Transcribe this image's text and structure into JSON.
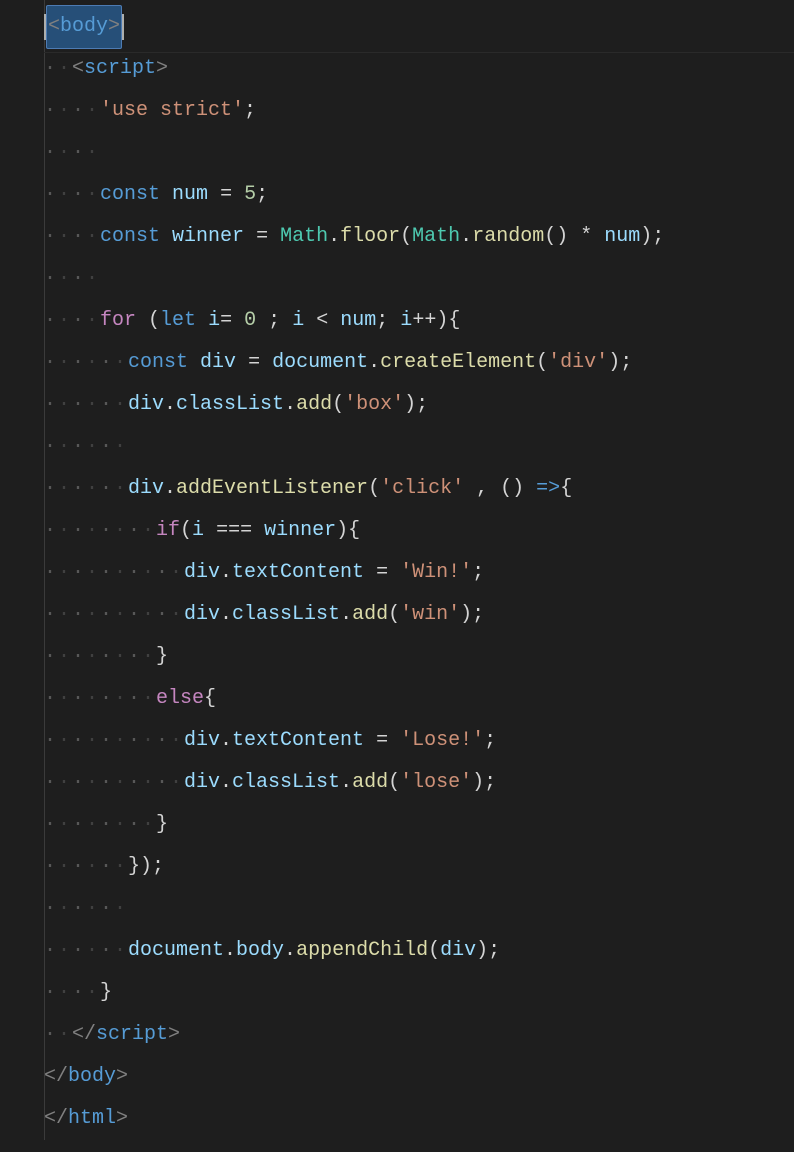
{
  "code": {
    "l1_bracket_open": "<",
    "l1_tag": "body",
    "l1_bracket_close": ">",
    "l2_open": "<",
    "l2_tag": "script",
    "l2_close": ">",
    "l3_str": "'use strict'",
    "l3_semi": ";",
    "l5_const": "const",
    "l5_var": "num",
    "l5_eq": "=",
    "l5_val": "5",
    "l5_semi": ";",
    "l6_const": "const",
    "l6_var": "winner",
    "l6_eq": "=",
    "l6_obj": "Math",
    "l6_dot1": ".",
    "l6_floor": "floor",
    "l6_p1": "(",
    "l6_obj2": "Math",
    "l6_dot2": ".",
    "l6_rand": "random",
    "l6_p2": "()",
    "l6_sp": " ",
    "l6_star": "*",
    "l6_numv": "num",
    "l6_p3": ")",
    "l6_semi": ";",
    "l8_for": "for",
    "l8_p1": "(",
    "l8_let": "let",
    "l8_i": "i",
    "l8_eq": "=",
    "l8_zero": "0",
    "l8_semi1": ";",
    "l8_i2": "i",
    "l8_lt": "<",
    "l8_num": "num",
    "l8_semi2": ";",
    "l8_i3": "i",
    "l8_inc": "++",
    "l8_p2": ")",
    "l8_brace": "{",
    "l9_const": "const",
    "l9_div": "div",
    "l9_eq": "=",
    "l9_doc": "document",
    "l9_dot": ".",
    "l9_ce": "createElement",
    "l9_p1": "(",
    "l9_str": "'div'",
    "l9_p2": ")",
    "l9_semi": ";",
    "l10_div": "div",
    "l10_dot1": ".",
    "l10_cl": "classList",
    "l10_dot2": ".",
    "l10_add": "add",
    "l10_p1": "(",
    "l10_str": "'box'",
    "l10_p2": ")",
    "l10_semi": ";",
    "l12_div": "div",
    "l12_dot": ".",
    "l12_ael": "addEventListener",
    "l12_p1": "(",
    "l12_str": "'click'",
    "l12_comma": ",",
    "l12_par": "()",
    "l12_arrow": "=>",
    "l12_brace": "{",
    "l13_if": "if",
    "l13_p1": "(",
    "l13_i": "i",
    "l13_eq": "===",
    "l13_win": "winner",
    "l13_p2": ")",
    "l13_brace": "{",
    "l14_div": "div",
    "l14_dot": ".",
    "l14_tc": "textContent",
    "l14_eq": "=",
    "l14_str": "'Win!'",
    "l14_semi": ";",
    "l15_div": "div",
    "l15_dot1": ".",
    "l15_cl": "classList",
    "l15_dot2": ".",
    "l15_add": "add",
    "l15_p1": "(",
    "l15_str": "'win'",
    "l15_p2": ")",
    "l15_semi": ";",
    "l16_brace": "}",
    "l17_else": "else",
    "l17_brace": "{",
    "l18_div": "div",
    "l18_dot": ".",
    "l18_tc": "textContent",
    "l18_eq": "=",
    "l18_str": "'Lose!'",
    "l18_semi": ";",
    "l19_div": "div",
    "l19_dot1": ".",
    "l19_cl": "classList",
    "l19_dot2": ".",
    "l19_add": "add",
    "l19_p1": "(",
    "l19_str": "'lose'",
    "l19_p2": ")",
    "l19_semi": ";",
    "l20_brace": "}",
    "l21_brace": "}",
    "l21_p": ")",
    "l21_semi": ";",
    "l23_doc": "document",
    "l23_dot1": ".",
    "l23_body": "body",
    "l23_dot2": ".",
    "l23_ac": "appendChild",
    "l23_p1": "(",
    "l23_div": "div",
    "l23_p2": ")",
    "l23_semi": ";",
    "l24_brace": "}",
    "l25_open": "</",
    "l25_tag": "script",
    "l25_close": ">",
    "l26_open": "</",
    "l26_tag": "body",
    "l26_close": ">",
    "l27_open": "</",
    "l27_tag": "html",
    "l27_close": ">"
  }
}
